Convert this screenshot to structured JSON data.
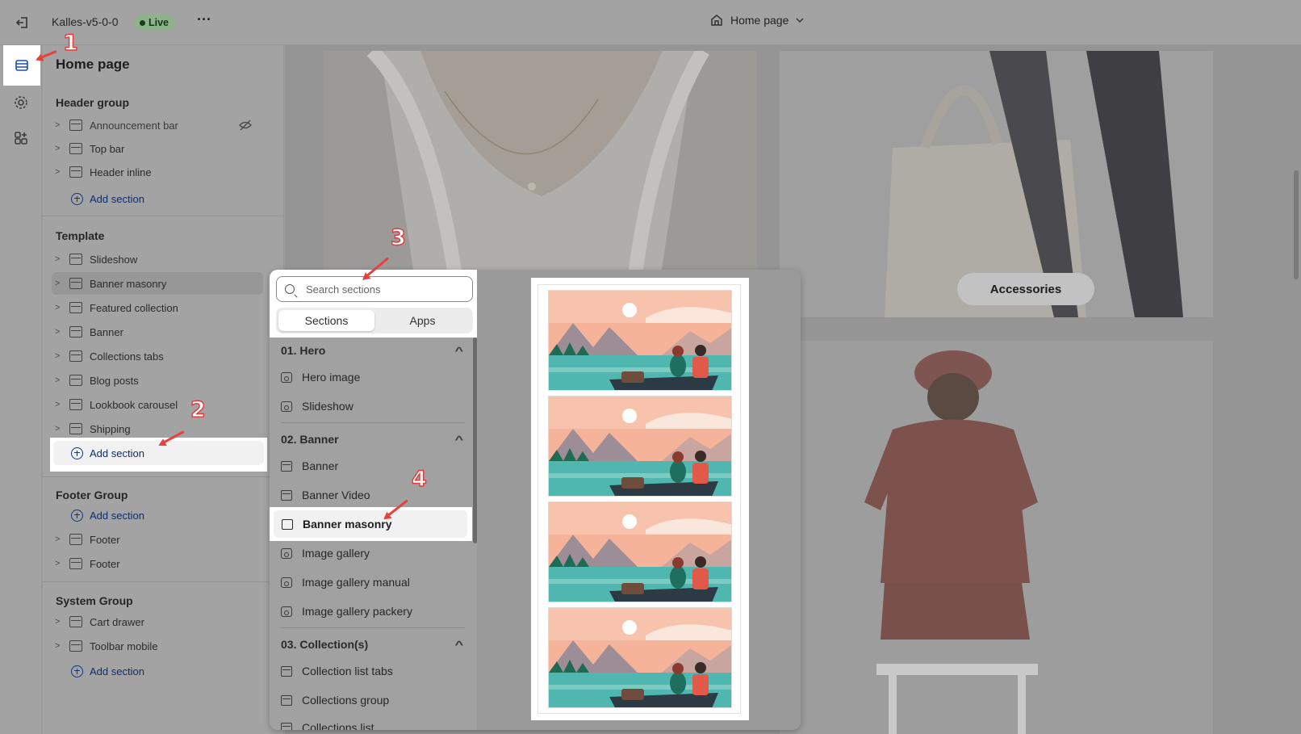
{
  "topbar": {
    "store_name": "Kalles-v5-0-0",
    "status_badge": "Live",
    "more_label": "···",
    "page_selector": "Home page"
  },
  "rail": {
    "items": [
      {
        "icon": "sections-icon"
      },
      {
        "icon": "settings-icon"
      },
      {
        "icon": "apps-icon"
      }
    ]
  },
  "sidebar": {
    "title": "Home page",
    "header_group": {
      "heading": "Header group",
      "sections": [
        "Announcement bar",
        "Top bar",
        "Header inline"
      ],
      "add_label": "Add section"
    },
    "template": {
      "heading": "Template",
      "sections": [
        "Slideshow",
        "Banner masonry",
        "Featured collection",
        "Banner",
        "Collections tabs",
        "Blog posts",
        "Lookbook carousel",
        "Shipping"
      ],
      "add_label": "Add section"
    },
    "footer_group": {
      "heading": "Footer Group",
      "add_label": "Add section",
      "sections": [
        "Footer",
        "Footer"
      ]
    },
    "system_group": {
      "heading": "System Group",
      "sections": [
        "Cart drawer",
        "Toolbar mobile"
      ],
      "add_label": "Add section"
    }
  },
  "picker": {
    "search_placeholder": "Search sections",
    "tabs": [
      "Sections",
      "Apps"
    ],
    "categories": [
      {
        "title": "01. Hero",
        "items": [
          "Hero image",
          "Slideshow"
        ]
      },
      {
        "title": "02. Banner",
        "items": [
          "Banner",
          "Banner Video",
          "Banner masonry",
          "Image gallery",
          "Image gallery manual",
          "Image gallery packery"
        ]
      },
      {
        "title": "03. Collection(s)",
        "items": [
          "Collection list tabs",
          "Collections group",
          "Collections list"
        ]
      }
    ]
  },
  "canvas": {
    "pill_label": "Accessories"
  },
  "annotations": [
    "1",
    "2",
    "3",
    "4"
  ],
  "colors": {
    "accent": "#e8413d",
    "link": "#12357d",
    "live": "#8fb28d"
  }
}
